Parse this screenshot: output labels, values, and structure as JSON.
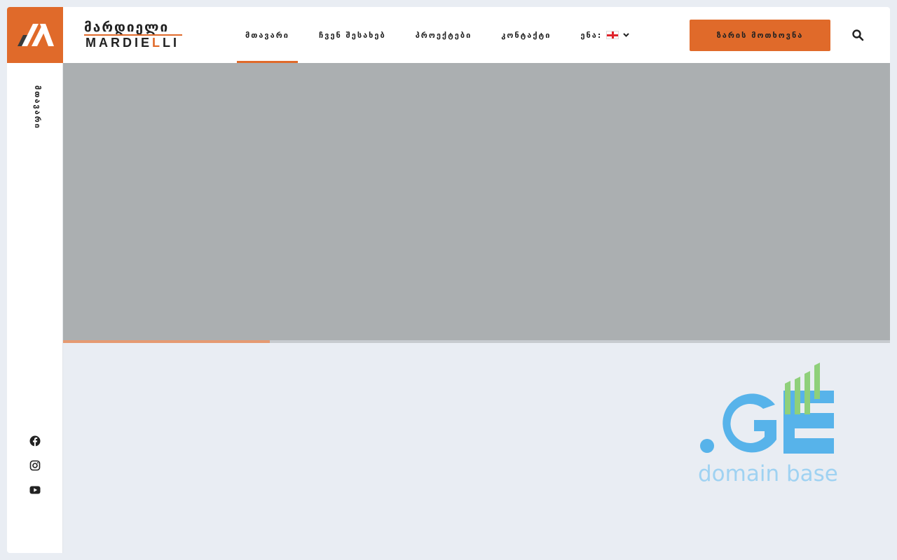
{
  "brand": {
    "name_ka": "მარდიელი",
    "name_lat_pre": "MARDIE",
    "name_lat_accent": "L",
    "name_lat_post": "LI",
    "accent_color": "#e06a2a"
  },
  "nav": {
    "items": [
      {
        "label": "მთავარი",
        "active": true
      },
      {
        "label": "ჩვენ შესახებ",
        "active": false
      },
      {
        "label": "პროექტები",
        "active": false
      },
      {
        "label": "კონტაქტი",
        "active": false
      }
    ],
    "language": {
      "label": "ენა:",
      "flag_icon": "georgia-flag-icon"
    }
  },
  "cta": {
    "label": "ზარის მოთხოვნა"
  },
  "search": {
    "icon": "search-icon"
  },
  "sidebar": {
    "label": "მთავარი",
    "social": [
      "facebook-icon",
      "instagram-icon",
      "youtube-icon"
    ]
  },
  "hero": {
    "background_color": "#abafb1",
    "slider_progress": 0.25
  },
  "watermark": {
    "mark": ".GE",
    "text": "domain base",
    "mark_color": "#57b3ea",
    "bars_color": "#8fd07a"
  }
}
